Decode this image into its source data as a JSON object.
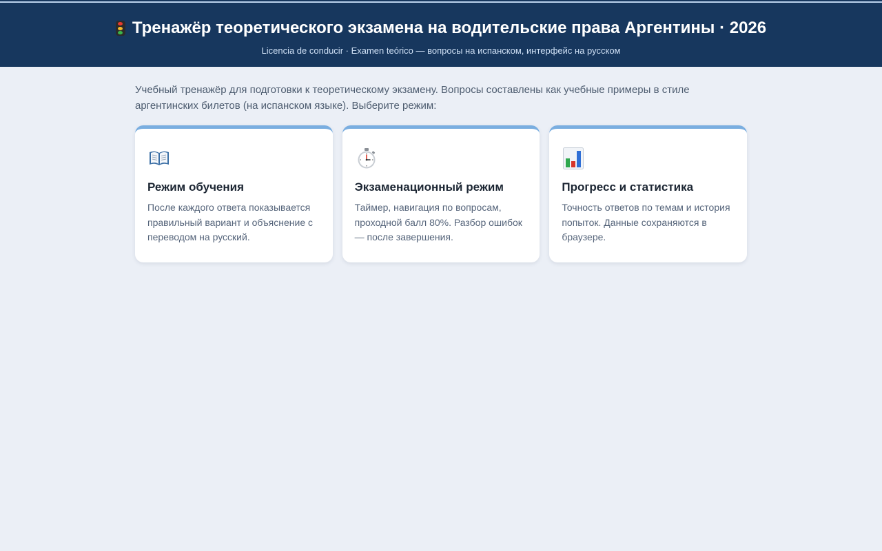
{
  "header": {
    "icon": "traffic-light-icon",
    "title": "Тренажёр теоретического экзамена на водительские права Аргентины · 2026",
    "subtitle": "Licencia de conducir · Examen teórico — вопросы на испанском, интерфейс на русском",
    "background_color": "#17375e"
  },
  "intro": "Учебный тренажёр для подготовки к теоретическому экзамену. Вопросы составлены как учебные примеры в стиле аргентинских билетов (на испанском языке). Выберите режим:",
  "cards": [
    {
      "icon": "open-book-icon",
      "title": "Режим обучения",
      "description": "После каждого ответа показывается правильный вариант и объяснение с переводом на русский."
    },
    {
      "icon": "stopwatch-icon",
      "title": "Экзаменационный режим",
      "description": "Таймер, навигация по вопросам, проходной балл 80%. Разбор ошибок — после завершения."
    },
    {
      "icon": "bar-chart-icon",
      "title": "Прогресс и статистика",
      "description": "Точность ответов по темам и история попыток. Данные сохраняются в браузере."
    }
  ],
  "colors": {
    "accent": "#7aaee0",
    "page_background": "#ebeff6"
  }
}
